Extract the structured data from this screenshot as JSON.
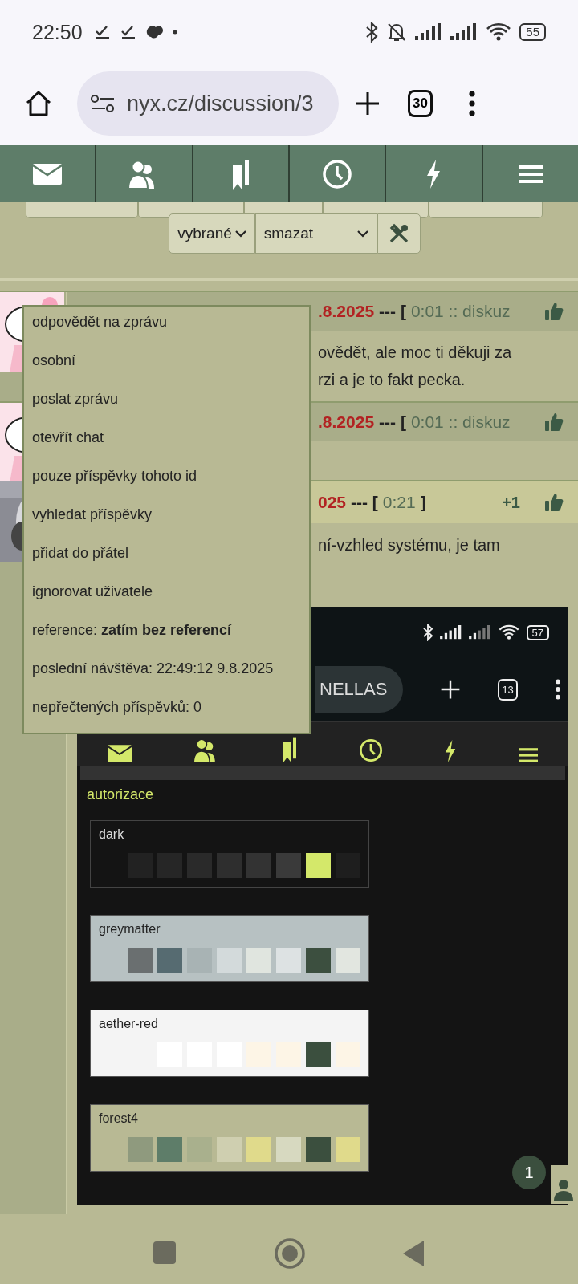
{
  "status_bar": {
    "time": "22:50",
    "battery": "55"
  },
  "browser": {
    "url": "nyx.cz/discussion/3",
    "tab_count": "30"
  },
  "toolbar": {
    "select_1": "vybrané",
    "select_2": "smazat"
  },
  "posts": [
    {
      "date": ".8.2025",
      "separator": "--- [",
      "meta": "0:01 :: diskuz",
      "highlighted": false,
      "lines": [
        "ovědět, ale moc ti děkuji za",
        "rzi a je to fakt pecka."
      ]
    },
    {
      "date": ".8.2025",
      "separator": "--- [",
      "meta": "0:01 :: diskuz",
      "highlighted": false
    },
    {
      "date": "025",
      "separator": "--- [",
      "meta": "0:21",
      "close": "]",
      "votes": "+1",
      "highlighted": true,
      "lines": [
        "ní-vzhled systému, je tam"
      ]
    }
  ],
  "context_menu": {
    "items": [
      "odpovědět na zprávu",
      "osobní",
      "poslat zprávu",
      "otevřít chat",
      "pouze příspěvky tohoto id",
      "vyhledat příspěvky",
      "přidat do přátel",
      "ignorovat uživatele",
      "reference: **zatím bez referencí**",
      "poslední návštěva: 22:49:12 9.8.2025",
      "nepřečtených příspěvků: 0"
    ]
  },
  "embedded_screenshot": {
    "battery": "57",
    "url": "NELLAS",
    "tab_count": "13",
    "section": "autorizace",
    "themes": [
      {
        "name": "dark",
        "color": "#141414",
        "swatches": [
          {
            "color": "#222222"
          },
          {
            "color": "#262626"
          },
          {
            "color": "#2a2a2a"
          },
          {
            "color": "#2e2e2e"
          },
          {
            "color": "#333333"
          },
          {
            "color": "#3a3a3a"
          },
          {
            "color": "#d4e86a"
          },
          {
            "color": "#1e1e1e"
          }
        ]
      },
      {
        "name": "greymatter",
        "color": "#b7c1c2",
        "swatches": [
          {
            "color": "#6a6f70"
          },
          {
            "color": "#566b71"
          },
          {
            "color": "#a8b3b4"
          },
          {
            "color": "#d3dadb"
          },
          {
            "color": "#e0e5df"
          },
          {
            "color": "#dde2e3"
          },
          {
            "color": "#3c4f3f"
          },
          {
            "color": "#e2e6e0"
          }
        ]
      },
      {
        "name": "aether-red",
        "color": "#f4f4f4",
        "swatches": [
          {
            "color": "#ffffff"
          },
          {
            "color": "#ffffff"
          },
          {
            "color": "#ffffff"
          },
          {
            "color": "#fdf5e6"
          },
          {
            "color": "#fdf5e6"
          },
          {
            "color": "#3b4f3e"
          },
          {
            "color": "#fdf5e6"
          }
        ]
      },
      {
        "name": "forest4",
        "color": "#b8b994",
        "swatches": [
          {
            "color": "#8f9a7e"
          },
          {
            "color": "#5e7d69"
          },
          {
            "color": "#a9b08d"
          },
          {
            "color": "#cfcfb0"
          },
          {
            "color": "#e0da8b"
          },
          {
            "color": "#d7d9c0"
          },
          {
            "color": "#3b4f3e"
          },
          {
            "color": "#e0da8b"
          }
        ]
      }
    ]
  },
  "chat_badge": {
    "count": "1"
  }
}
